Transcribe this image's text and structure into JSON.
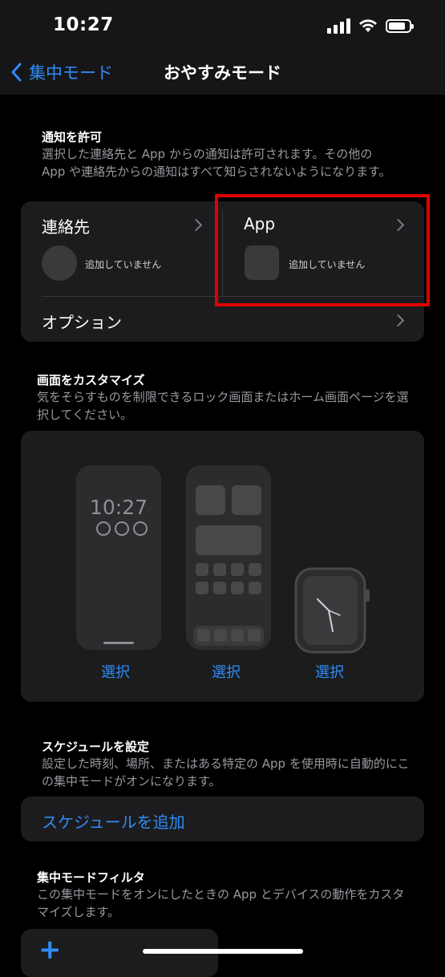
{
  "status": {
    "time": "10:27"
  },
  "nav": {
    "back_label": "集中モード",
    "title": "おやすみモード"
  },
  "notifications": {
    "header": "通知を許可",
    "description": "選択した連絡先と App からの通知は許可されます。その他の App や連絡先からの通知はすべて知らされないようになります。",
    "contacts": {
      "label": "連絡先",
      "status": "追加していません"
    },
    "apps": {
      "label": "App",
      "status": "追加していません"
    },
    "options_label": "オプション"
  },
  "customize": {
    "header": "画面をカスタマイズ",
    "description": "気をそらすものを制限できるロック画面またはホーム画面ページを選択してください。",
    "lock_time": "10:27",
    "select_labels": [
      "選択",
      "選択",
      "選択"
    ]
  },
  "schedule": {
    "header": "スケジュールを設定",
    "description": "設定した時刻、場所、またはある特定の App を使用時に自動的にこの集中モードがオンになります。",
    "add_label": "スケジュールを追加"
  },
  "filters": {
    "header": "集中モードフィルタ",
    "description": "この集中モードをオンにしたときの App とデバイスの動作をカスタマイズします。",
    "add_symbol": "+"
  },
  "colors": {
    "accent": "#2f8cf5",
    "highlight": "#e00000",
    "card": "#1c1c1e"
  },
  "battery_level": 0.85
}
